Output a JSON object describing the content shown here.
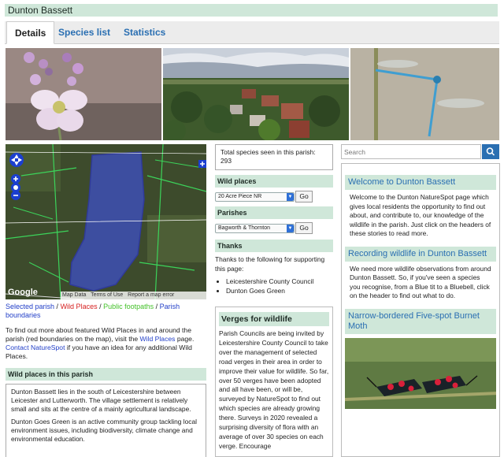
{
  "title": "Dunton Bassett",
  "tabs": [
    {
      "label": "Details",
      "active": true
    },
    {
      "label": "Species list",
      "active": false
    },
    {
      "label": "Statistics",
      "active": false
    }
  ],
  "map": {
    "attribution_1": "Map Data",
    "attribution_2": "Terms of Use",
    "attribution_3": "Report a map error",
    "logo": "Google"
  },
  "legend": {
    "selected": "Selected parish",
    "sep1": " / ",
    "wild": "Wild Places",
    "sep2": " / ",
    "paths": "Public footpaths",
    "sep3": " / ",
    "boundaries": "Parish boundaries"
  },
  "intro": {
    "before_link": "To find out more about featured Wild Places in and around the parish (red boundaries on the map), visit the ",
    "link1": "Wild Places",
    "middle": " page. ",
    "link2": "Contact NatureSpot",
    "after": " if you have an idea for any additional Wild Places."
  },
  "wild_places_heading": "Wild places in this parish",
  "wild_places_text": [
    "Dunton Bassett lies in the south of Leicestershire between Leicester and Lutterworth. The village settlement is relatively small and sits at the centre of a mainly agricultural landscape.",
    "Dunton Goes Green is an active community group tackling local environment issues, including biodiversity, climate change and environmental education."
  ],
  "total_species": {
    "label": "Total species seen in this parish:",
    "value": "293"
  },
  "wild_places_select": {
    "heading": "Wild places",
    "value": "20 Acre Piece NR",
    "go": "Go"
  },
  "parishes_select": {
    "heading": "Parishes",
    "value": "Bagworth & Thornton",
    "go": "Go"
  },
  "thanks": {
    "heading": "Thanks",
    "text": "Thanks to the following for supporting this page:",
    "items": [
      "Leicestershire County Council",
      "Dunton Goes Green"
    ]
  },
  "verges": {
    "heading": "Verges for wildlife",
    "text": "Parish Councils are being invited by Leicestershire County Council to take over the management of selected road verges in their area in order to improve their value for wildlife. So far, over 50 verges have been adopted and all have been, or will be, surveyed by NatureSpot to find out which species are already growing there. Surveys in 2020 revealed a surprising diversity of flora with an average of over 30 species on each verge. Encourage"
  },
  "search": {
    "placeholder": "Search"
  },
  "sidebar": [
    {
      "title": "Welcome to Dunton Bassett",
      "text": "Welcome to the Dunton NatureSpot page which gives local residents the opportunity to find out about, and contribute to, our knowledge of the wildlife in the parish. Just click on the headers of these stories to read more."
    },
    {
      "title": "Recording wildlife in Dunton Bassett",
      "text": "We need more wildlife observations from around Dunton Bassett. So, if you've seen a species you recognise, from a Blue tit to a Bluebell, click on the header to find out what to do."
    },
    {
      "title": "Narrow-bordered Five-spot Burnet Moth",
      "text": ""
    }
  ],
  "colors": {
    "accent": "#2a6fb2",
    "bar": "#cfe7d9",
    "parish_fill": "#3d4fc7"
  }
}
